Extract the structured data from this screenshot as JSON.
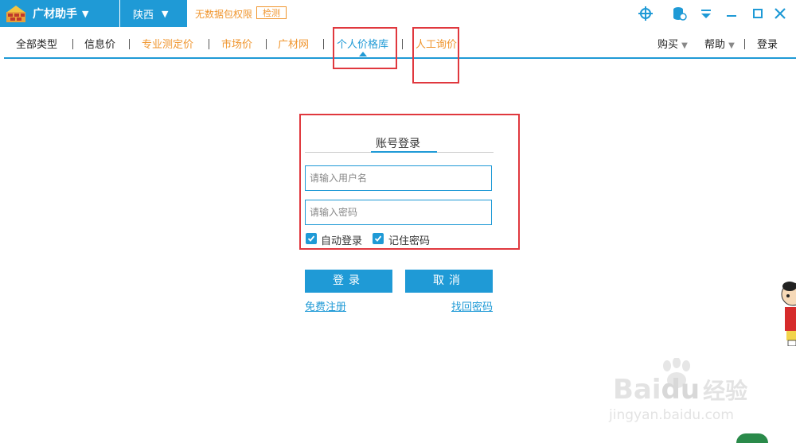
{
  "titlebar": {
    "app_name": "广材助手",
    "region": "陕西",
    "data_notice": "无数据包权限",
    "detect_label": "检测"
  },
  "nav": {
    "items": [
      {
        "label": "全部类型"
      },
      {
        "label": "信息价"
      },
      {
        "label": "专业测定价"
      },
      {
        "label": "市场价"
      },
      {
        "label": "广材网"
      },
      {
        "label": "个人价格库"
      },
      {
        "label": "人工询价"
      }
    ],
    "buy_label": "购买",
    "help_label": "帮助",
    "login_label": "登录"
  },
  "login": {
    "tab_title": "账号登录",
    "username_placeholder": "请输入用户名",
    "password_placeholder": "请输入密码",
    "auto_login_label": "自动登录",
    "remember_password_label": "记住密码",
    "login_button": "登录",
    "cancel_button": "取消",
    "register_link": "免费注册",
    "recover_link": "找回密码"
  },
  "watermark": {
    "brand": "Bai",
    "brand_du": "du",
    "brand_cn": "经验",
    "url": "jingyan.baidu.com"
  },
  "colors": {
    "accent": "#1f9ad6",
    "orange": "#f0962f",
    "highlight_red": "#e0383e"
  }
}
